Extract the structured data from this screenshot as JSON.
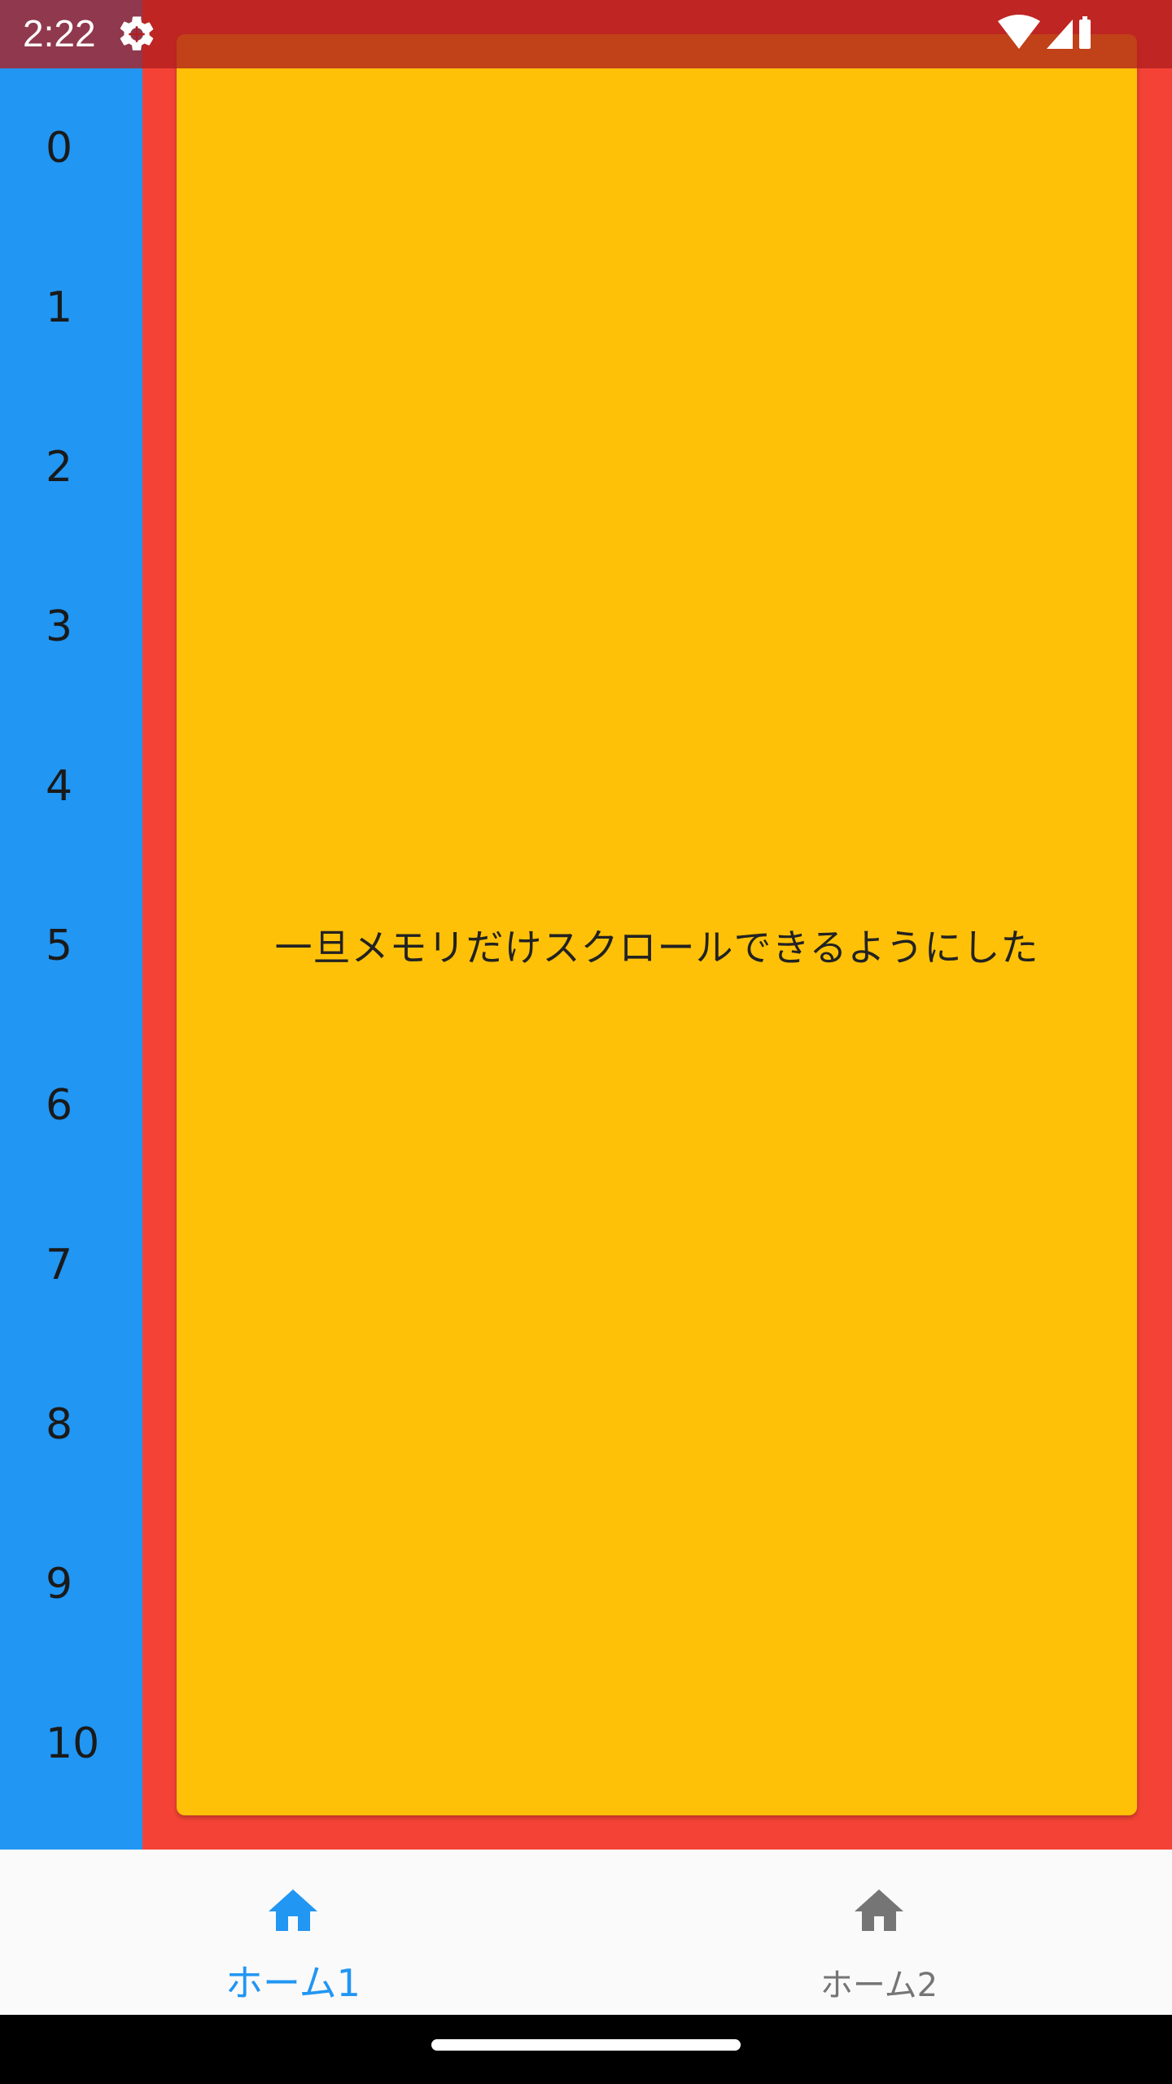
{
  "status_bar": {
    "time": "2:22",
    "icons": [
      "settings-gear-icon",
      "wifi-icon",
      "cell-signal-icon",
      "battery-icon"
    ]
  },
  "side_list": {
    "items": [
      "0",
      "1",
      "2",
      "3",
      "4",
      "5",
      "6",
      "7",
      "8",
      "9",
      "10"
    ]
  },
  "card": {
    "message": "一旦メモリだけスクロールできるようにした"
  },
  "bottom_nav": {
    "items": [
      {
        "label": "ホーム1",
        "icon": "home-icon",
        "active": true
      },
      {
        "label": "ホーム2",
        "icon": "home-icon",
        "active": false
      }
    ]
  },
  "colors": {
    "primary": "#2196f3",
    "side_list_bg": "#2196f3",
    "red_area_bg": "#f44336",
    "card_bg": "#ffc107",
    "status_bar_bg": "#b01e1e",
    "nav_bg": "#fafafa",
    "nav_inactive": "#757575"
  }
}
